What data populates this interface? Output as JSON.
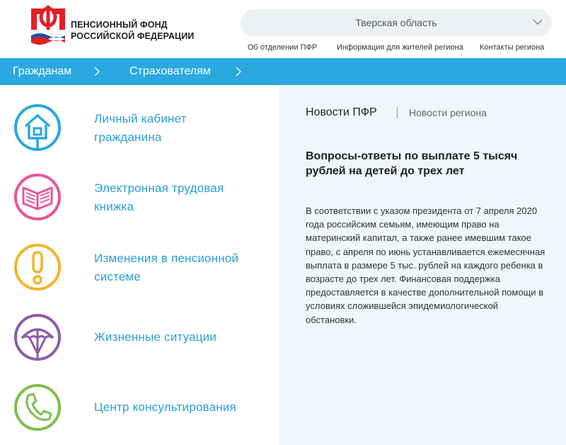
{
  "header": {
    "org_name_line1": "ПЕНСИОННЫЙ ФОНД",
    "org_name_line2": "РОССИЙСКОЙ ФЕДЕРАЦИИ",
    "logo_icon": "pfr-logo-icon",
    "region_select": {
      "value": "Тверская область",
      "icon": "chevron-down-icon"
    },
    "top_links": [
      {
        "label": "Об отделении  ПФР"
      },
      {
        "label": "Информация для жителей региона"
      },
      {
        "label": "Контакты региона"
      }
    ]
  },
  "navbar": {
    "color": "#2aa8e0",
    "items": [
      {
        "label": "Гражданам"
      },
      {
        "label": "Страхователям"
      }
    ]
  },
  "menu": {
    "items": [
      {
        "line1": "Личный кабинет",
        "line2": "гражданина",
        "icon": "house-icon",
        "color": "#2aa8e0"
      },
      {
        "line1": "Электронная трудовая",
        "line2": "книжка",
        "icon": "book-icon",
        "color": "#e8559a"
      },
      {
        "line1": "Изменения в пенсионной",
        "line2": "системе",
        "icon": "exclamation-icon",
        "color": "#f2b531"
      },
      {
        "line1": "Жизненные ситуации",
        "line2": "",
        "icon": "umbrella-icon",
        "color": "#8d5ca8"
      },
      {
        "line1": "Центр консультирования",
        "line2": "",
        "icon": "phone-icon",
        "color": "#7cbf4a"
      }
    ]
  },
  "news": {
    "tab_main": "Новости ПФР",
    "tab_region": "Новости региона",
    "title": "Вопросы-ответы по выплате 5 тысяч рублей на детей до трех лет",
    "body": "В соответствии с указом президента от 7 апреля 2020 года российским семьям, имеющим право на материнский капитал, а также ранее имевшим такое право, с апреля по июнь устанавливается ежемесячная выплата в размере 5 тыс. рублей на каждого ребенка в возрасте до трех лет. Финансовая поддержка предоставляется в качестве дополнительной помощи в условиях сложившейся эпидемиологической обстановки."
  }
}
